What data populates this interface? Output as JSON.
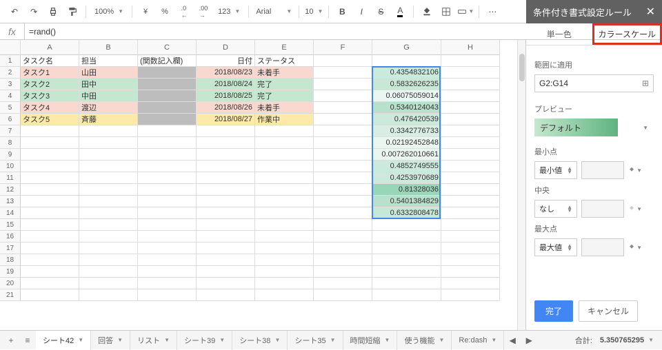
{
  "toolbar": {
    "zoom": "100%",
    "currency": "¥",
    "percent": "%",
    "dec_dec": ".0",
    "dec_inc": ".00",
    "format": "123",
    "font": "Arial",
    "font_size": "10",
    "bold": "B",
    "italic": "I",
    "strike": "S"
  },
  "fx": {
    "label": "fx",
    "value": "=rand()"
  },
  "columns": [
    "A",
    "B",
    "C",
    "D",
    "E",
    "F",
    "G",
    "H"
  ],
  "row_count": 21,
  "headers": {
    "A": "タスク名",
    "B": "担当",
    "C": "(関数記入欄)",
    "D": "日付",
    "E": "ステータス"
  },
  "rows": [
    {
      "A": "タスク1",
      "B": "山田",
      "D": "2018/08/23",
      "E": "未着手",
      "G": "0.4354832106",
      "fillA": "#f9d8d0",
      "fillB": "#f9d8d0",
      "fillC": "#bdbdbd",
      "fillD": "#f9d8d0",
      "fillE": "#f9d8d0",
      "gcls": "g-grad5"
    },
    {
      "A": "タスク2",
      "B": "田中",
      "D": "2018/08/24",
      "E": "完了",
      "G": "0.5832626235",
      "fillA": "#c6e7cf",
      "fillB": "#c6e7cf",
      "fillC": "#bdbdbd",
      "fillD": "#c6e7cf",
      "fillE": "#c6e7cf",
      "gcls": "g-grad2"
    },
    {
      "A": "タスク3",
      "B": "中田",
      "D": "2018/08/25",
      "E": "完了",
      "G": "0.06075059014",
      "fillA": "#c6e7cf",
      "fillB": "#c6e7cf",
      "fillC": "#bdbdbd",
      "fillD": "#c6e7cf",
      "fillE": "#c6e7cf",
      "gcls": "g-grad8"
    },
    {
      "A": "タスク4",
      "B": "渡辺",
      "D": "2018/08/26",
      "E": "未着手",
      "G": "0.5340124043",
      "fillA": "#f9d8d0",
      "fillB": "#f9d8d0",
      "fillC": "#bdbdbd",
      "fillD": "#f9d8d0",
      "fillE": "#f9d8d0",
      "gcls": "g-grad4"
    },
    {
      "A": "タスク5",
      "B": "斉藤",
      "D": "2018/08/27",
      "E": "作業中",
      "G": "0.476420539",
      "fillA": "#fde9a8",
      "fillB": "#fde9a8",
      "fillC": "#bdbdbd",
      "fillD": "#fde9a8",
      "fillE": "#fde9a8",
      "gcls": "g-grad5"
    },
    {
      "G": "0.3342776733",
      "gcls": "g-grad6"
    },
    {
      "G": "0.02192452848",
      "gcls": "g-grad8"
    },
    {
      "G": "0.007262010661",
      "gcls": "g-grad8"
    },
    {
      "G": "0.4852749555",
      "gcls": "g-grad5"
    },
    {
      "G": "0.4253970689",
      "gcls": "g-grad5"
    },
    {
      "G": "0.81328036",
      "gcls": "g-grad11"
    },
    {
      "G": "0.5401384829",
      "gcls": "g-grad4"
    },
    {
      "G": "0.6332808478",
      "gcls": "g-grad2"
    }
  ],
  "panel": {
    "title": "条件付き書式設定ルール",
    "tab_single": "単一色",
    "tab_scale": "カラースケール",
    "range_label": "範囲に適用",
    "range_value": "G2:G14",
    "preview_label": "プレビュー",
    "preview_value": "デフォルト",
    "min_label": "最小点",
    "min_type": "最小値",
    "mid_label": "中央",
    "mid_type": "なし",
    "max_label": "最大点",
    "max_type": "最大値",
    "done": "完了",
    "cancel": "キャンセル"
  },
  "tabs": [
    "シート42",
    "回答",
    "リスト",
    "シート39",
    "シート38",
    "シート35",
    "時間短縮",
    "使う機能",
    "Re:dash"
  ],
  "active_tab": 0,
  "status": {
    "label": "合計:",
    "value": "5.350765295"
  }
}
